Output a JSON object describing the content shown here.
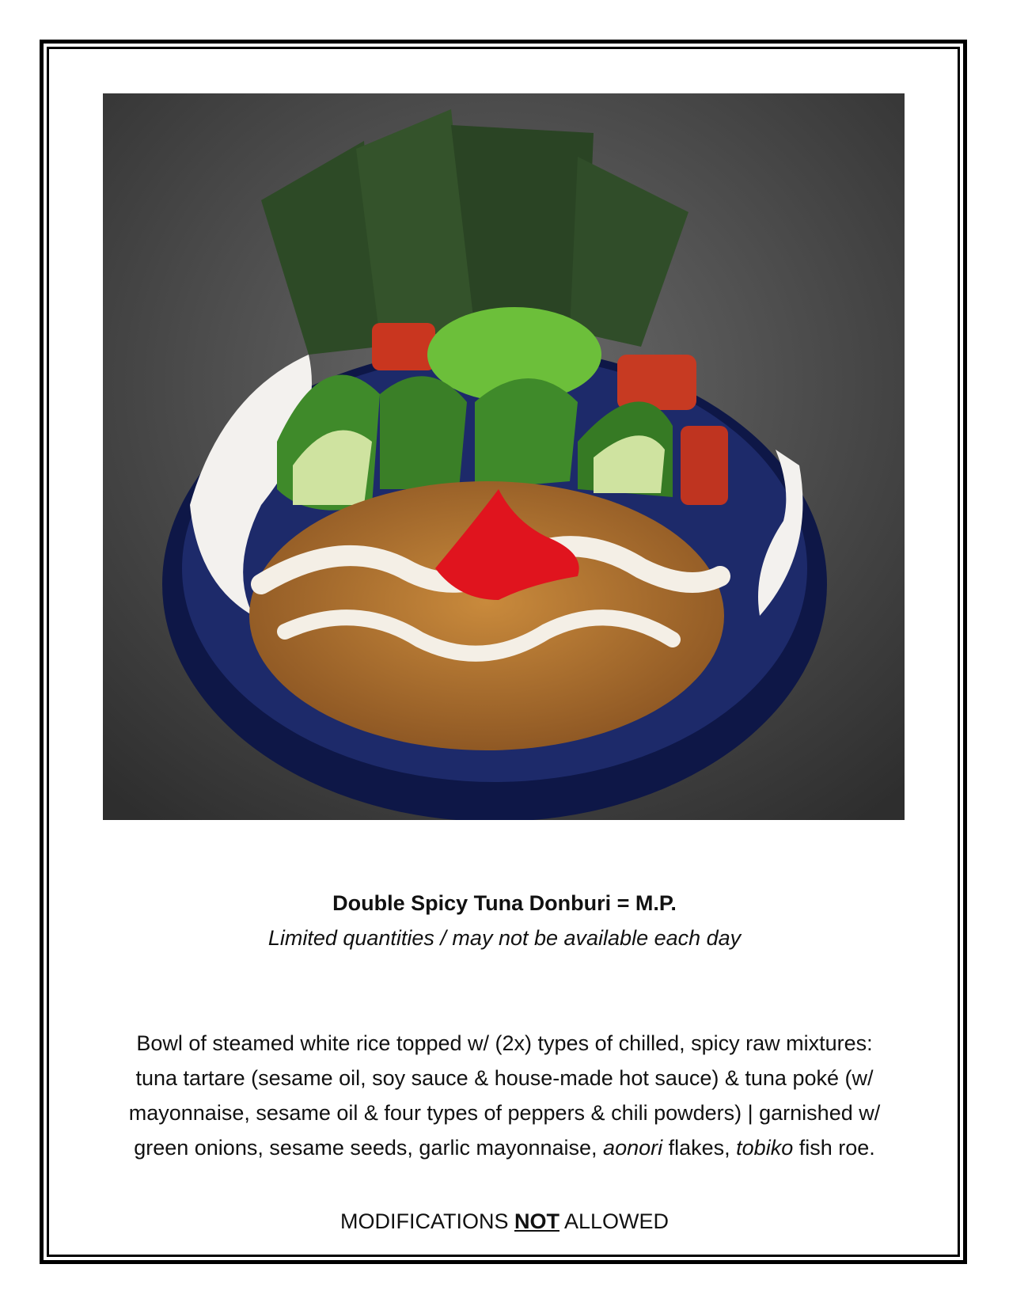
{
  "menu_item": {
    "title": "Double Spicy Tuna Donburi = M.P.",
    "subtitle": "Limited quantities / may not be available each day"
  },
  "description": {
    "line1": "Bowl of steamed white rice topped w/ (2x) types of chilled, spicy raw mixtures:",
    "line2": "tuna tartare (sesame oil, soy sauce & house-made hot sauce) & tuna poké (w/",
    "line3": "mayonnaise, sesame oil & four types of peppers & chili powders) | garnished w/",
    "line4_a": "green onions, sesame seeds, garlic mayonnaise, ",
    "line4_aonori": "aonori",
    "line4_b": " flakes, ",
    "line4_tobiko": "tobiko",
    "line4_c": " fish roe."
  },
  "notice": {
    "part1": "MODIFICATIONS ",
    "emphasis": "NOT",
    "part2": " ALLOWED"
  },
  "colors": {
    "border": "#000000",
    "bowl_blue": "#14205a",
    "tuna_red": "#c9361f",
    "cucumber": "#3f8a2a",
    "roe": "#e0141e",
    "nori": "#2f4a28"
  }
}
